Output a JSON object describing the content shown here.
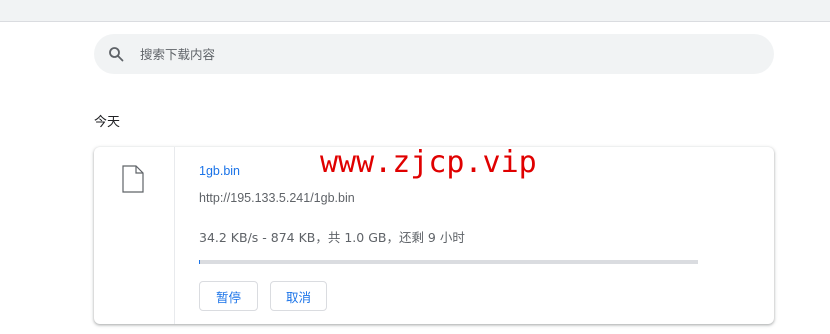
{
  "search": {
    "placeholder": "搜索下载内容",
    "icon": "search-icon"
  },
  "section": {
    "title": "今天"
  },
  "download": {
    "file_name": "1gb.bin",
    "url": "http://195.133.5.241/1gb.bin",
    "status": "34.2 KB/s - 874 KB，共 1.0 GB，还剩 9 小时",
    "progress_fraction": 0.0009,
    "icon": "file-icon",
    "buttons": {
      "pause": "暂停",
      "cancel": "取消"
    }
  },
  "watermark": {
    "text": "www.zjcp.vip"
  },
  "colors": {
    "accent": "#1a73e8",
    "watermark": "#e00000",
    "search_bg": "#f1f3f4"
  }
}
